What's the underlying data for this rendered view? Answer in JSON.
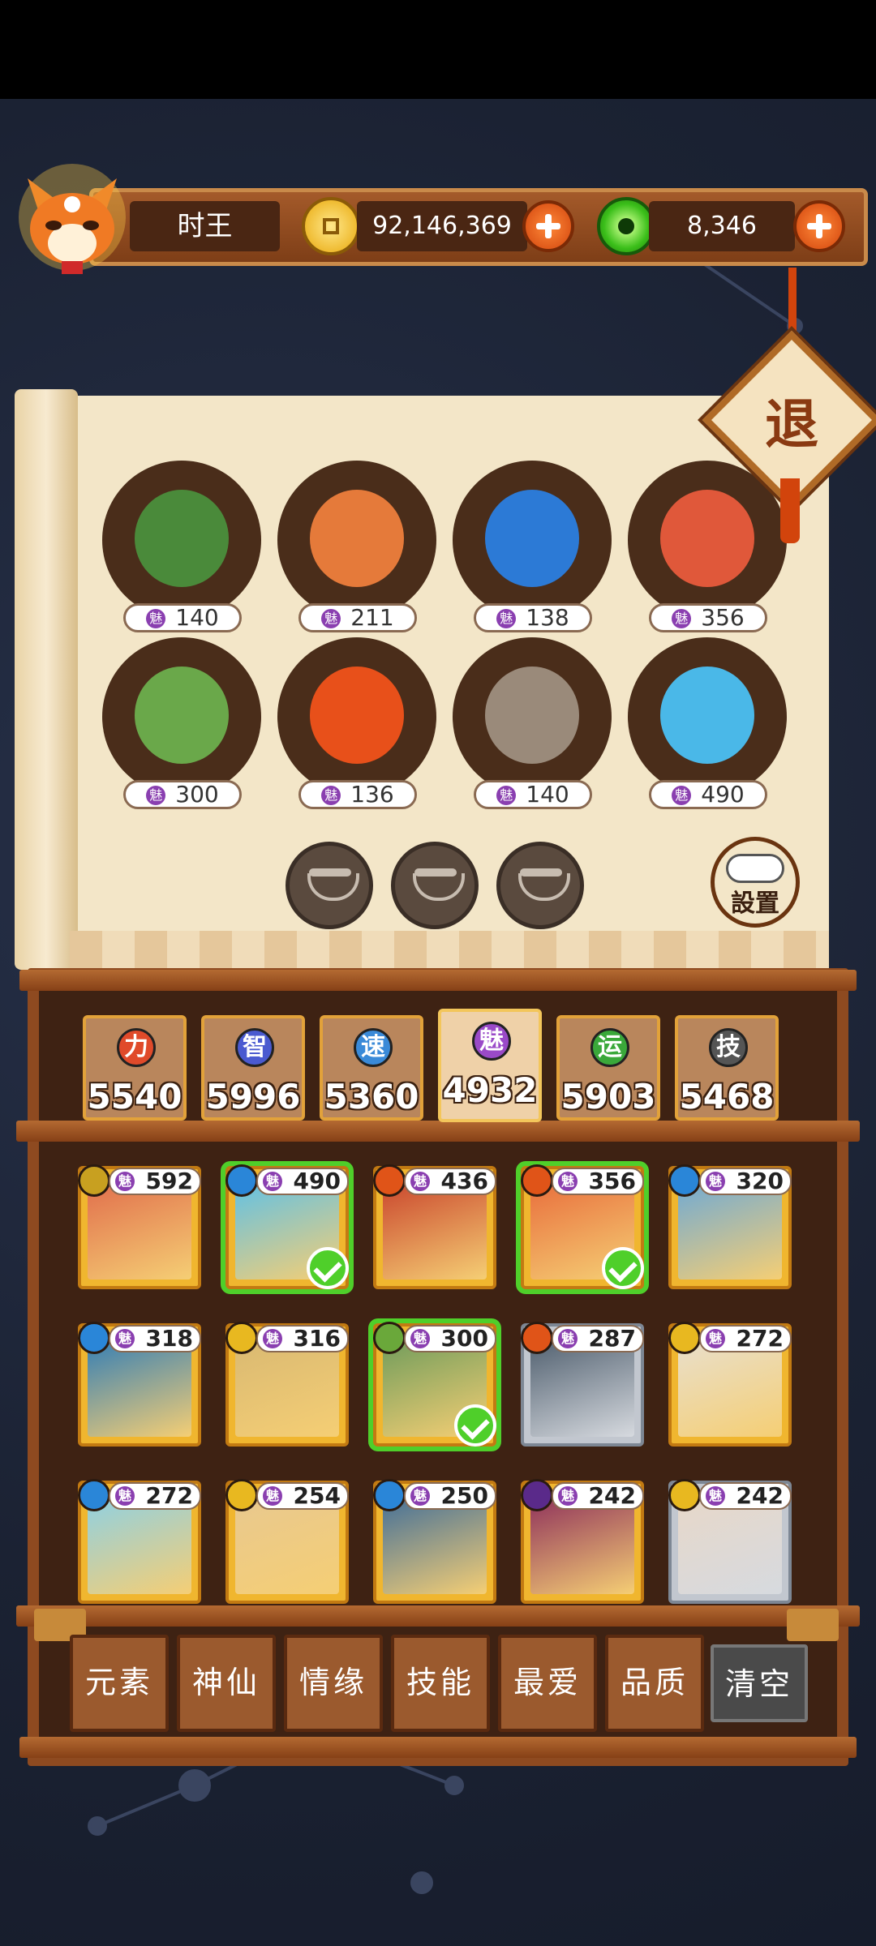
{
  "header": {
    "player_name": "时王",
    "gold_amount": "92,146,369",
    "jade_amount": "8,346"
  },
  "exit_label": "退",
  "settings_label": "設置",
  "roster": [
    {
      "charm": "140",
      "icon": "魅",
      "color": "#4a8a3a"
    },
    {
      "charm": "211",
      "icon": "魅",
      "color": "#e57a3a"
    },
    {
      "charm": "138",
      "icon": "魅",
      "color": "#2c7ad6"
    },
    {
      "charm": "356",
      "icon": "魅",
      "color": "#e0583a"
    },
    {
      "charm": "300",
      "icon": "魅",
      "color": "#6aa84a"
    },
    {
      "charm": "136",
      "icon": "魅",
      "color": "#e8501a"
    },
    {
      "charm": "140",
      "icon": "魅",
      "color": "#9a8a7a"
    },
    {
      "charm": "490",
      "icon": "魅",
      "color": "#4ab8e8"
    }
  ],
  "stats": [
    {
      "icon": "力",
      "value": "5540",
      "icon_color": "#e04a2a",
      "active": false
    },
    {
      "icon": "智",
      "value": "5996",
      "icon_color": "#4a5ad0",
      "active": false
    },
    {
      "icon": "速",
      "value": "5360",
      "icon_color": "#3a8ad8",
      "active": false
    },
    {
      "icon": "魅",
      "value": "4932",
      "icon_color": "#9a4ac8",
      "active": true
    },
    {
      "icon": "运",
      "value": "5903",
      "icon_color": "#3aa83a",
      "active": false
    },
    {
      "icon": "技",
      "value": "5468",
      "icon_color": "#555555",
      "active": false
    }
  ],
  "cards": [
    {
      "value": "592",
      "icon": "魅",
      "element": "earth",
      "selected": false,
      "art": "#e06a4a"
    },
    {
      "value": "490",
      "icon": "魅",
      "element": "water",
      "selected": true,
      "art": "#5ac0ea"
    },
    {
      "value": "436",
      "icon": "魅",
      "element": "fire",
      "selected": false,
      "art": "#c8402a"
    },
    {
      "value": "356",
      "icon": "魅",
      "element": "fire",
      "selected": true,
      "art": "#e86a3a"
    },
    {
      "value": "320",
      "icon": "魅",
      "element": "water",
      "selected": false,
      "art": "#6aa8d8"
    },
    {
      "value": "318",
      "icon": "魅",
      "element": "water",
      "selected": false,
      "art": "#2a7ab8"
    },
    {
      "value": "316",
      "icon": "魅",
      "element": "light",
      "selected": false,
      "art": "#d8b872"
    },
    {
      "value": "300",
      "icon": "魅",
      "element": "wood",
      "selected": true,
      "art": "#6a9a5a"
    },
    {
      "value": "287",
      "icon": "魅",
      "element": "fire",
      "selected": false,
      "art": "#4a5a6a",
      "silver": true
    },
    {
      "value": "272",
      "icon": "魅",
      "element": "light",
      "selected": false,
      "art": "#e8e0d0"
    },
    {
      "value": "272",
      "icon": "魅",
      "element": "water",
      "selected": false,
      "art": "#8ad0e8"
    },
    {
      "value": "254",
      "icon": "魅",
      "element": "light",
      "selected": false,
      "art": "#e8c890"
    },
    {
      "value": "250",
      "icon": "魅",
      "element": "water",
      "selected": false,
      "art": "#3a6a9a"
    },
    {
      "value": "242",
      "icon": "魅",
      "element": "dark",
      "selected": false,
      "art": "#8a2a5a"
    },
    {
      "value": "242",
      "icon": "魅",
      "element": "light",
      "selected": false,
      "art": "#e8d8c8",
      "silver": true
    }
  ],
  "filters": [
    "元素",
    "神仙",
    "情缘",
    "技能",
    "最爱",
    "品质"
  ],
  "clear_label": "清空",
  "element_colors": {
    "earth": "#c8a020",
    "water": "#2a86d8",
    "fire": "#e05418",
    "wood": "#6aa83a",
    "light": "#e8b820",
    "dark": "#5a2a8a"
  }
}
